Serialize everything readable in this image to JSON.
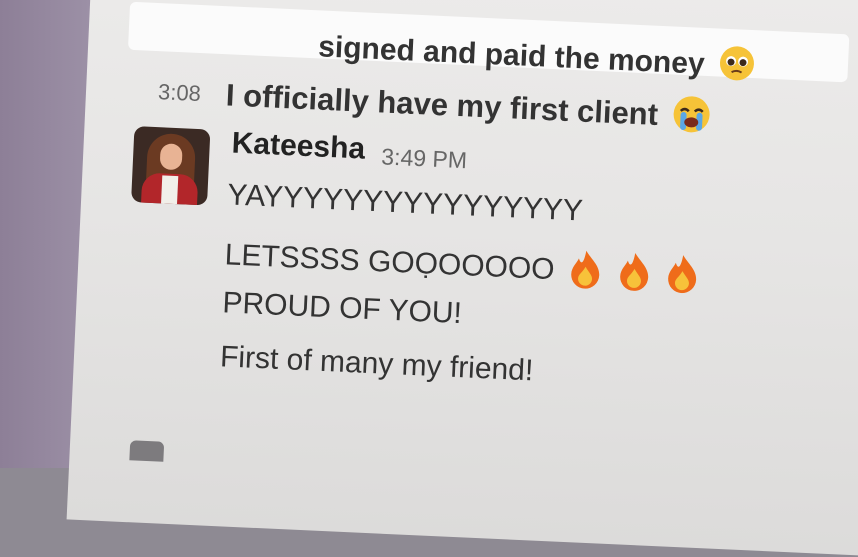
{
  "messages": {
    "top_line": "signed and paid the money",
    "top_line_emoji": "pleading-face",
    "second_timestamp": "3:08",
    "second_line": "I officially have my first client",
    "second_line_emoji": "loudly-crying-face"
  },
  "post": {
    "author": "Kateesha",
    "time": "3:49 PM",
    "lines": [
      "YAYYYYYYYYYYYYYYYY",
      "LETSSSS GOỌOOOOO",
      "PROUD OF YOU!",
      "First of many my friend!"
    ],
    "line2_emojis": [
      "fire",
      "fire",
      "fire"
    ]
  },
  "colors": {
    "sidebar": "#9c90a6",
    "message_bg": "#e8e7e6",
    "text": "#2a2a2a",
    "fire": "#ef6c1a"
  }
}
